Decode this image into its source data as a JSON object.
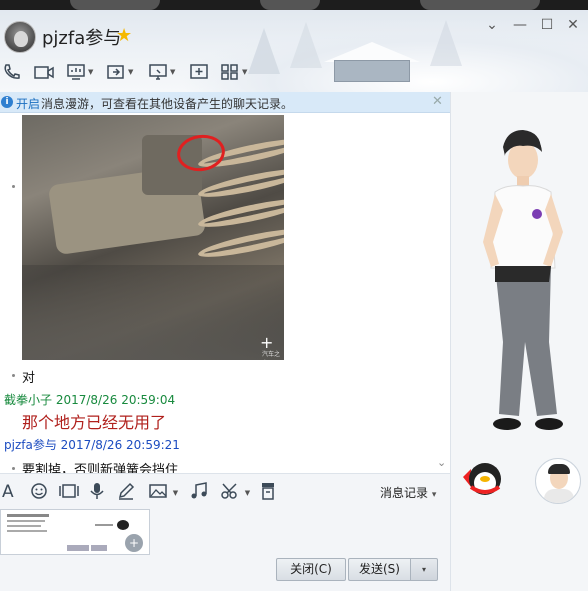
{
  "header": {
    "contact_name": "pjzfa参与",
    "window_buttons": {
      "settings": "⌄",
      "minimize": "—",
      "maximize": "☐",
      "close": "✕"
    }
  },
  "toolbar": {
    "icons": [
      "phone-icon",
      "video-call-icon",
      "screen-share-icon",
      "remote-assist-icon",
      "screen-capture-icon",
      "add-app-icon",
      "more-apps-icon"
    ]
  },
  "infobar": {
    "link": "开启",
    "text": "消息漫游，可查看在其他设备产生的聊天记录。",
    "close": "✕"
  },
  "photo": {
    "plus": "+",
    "watermark": "汽车之家"
  },
  "messages": [
    {
      "text": "对"
    },
    {
      "sender": "截拳小子",
      "time": "2017/8/26 20:59:04",
      "text": "那个地方已经无用了",
      "sender_color": "#188a3e"
    },
    {
      "sender": "pjzfa参与",
      "time": "2017/8/26 20:59:21",
      "text": "要割掉，否则新弹簧会挡住",
      "sender_color": "#1c4cc0"
    }
  ],
  "inputbar": {
    "icons": [
      "font-icon",
      "emoji-icon",
      "gif-icon",
      "voice-icon",
      "handwriting-icon",
      "image-icon",
      "music-icon",
      "screenshot-icon",
      "shake-icon"
    ],
    "history_label": "消息记录",
    "dropdown_glyph": "▾"
  },
  "actions": {
    "close_label": "关闭(C)",
    "send_label": "发送(S)",
    "send_dropdown": "▾"
  },
  "colors": {
    "accent": "#2e7fd0",
    "info_bg": "#d8e9f8",
    "message_red": "#b0201c"
  }
}
